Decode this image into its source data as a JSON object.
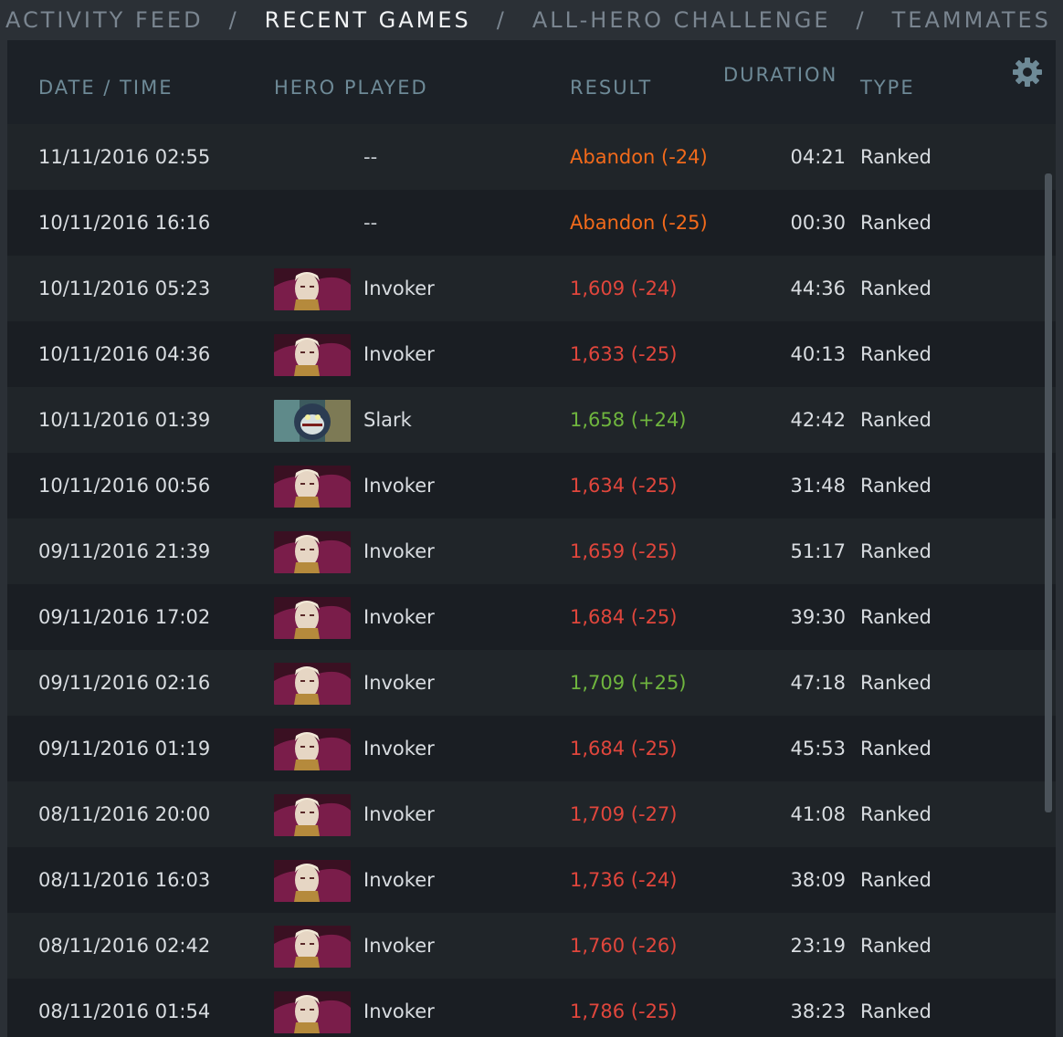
{
  "nav": {
    "tabs": [
      {
        "label": "ACTIVITY FEED",
        "active": false
      },
      {
        "label": "RECENT GAMES",
        "active": true
      },
      {
        "label": "ALL-HERO CHALLENGE",
        "active": false
      },
      {
        "label": "TEAMMATES",
        "active": false
      }
    ],
    "separator": "/"
  },
  "table": {
    "headers": {
      "date": "DATE / TIME",
      "hero": "HERO PLAYED",
      "result": "RESULT",
      "duration": "DURATION",
      "type": "TYPE"
    },
    "settings_icon": "gear-icon",
    "rows": [
      {
        "date": "11/11/2016  02:55",
        "hero": "--",
        "hero_icon": "",
        "result": "Abandon (-24)",
        "status": "abandon",
        "duration": "04:21",
        "type": "Ranked"
      },
      {
        "date": "10/11/2016  16:16",
        "hero": "--",
        "hero_icon": "",
        "result": "Abandon (-25)",
        "status": "abandon",
        "duration": "00:30",
        "type": "Ranked"
      },
      {
        "date": "10/11/2016  05:23",
        "hero": "Invoker",
        "hero_icon": "invoker-portrait",
        "result": "1,609 (-24)",
        "status": "loss",
        "duration": "44:36",
        "type": "Ranked"
      },
      {
        "date": "10/11/2016  04:36",
        "hero": "Invoker",
        "hero_icon": "invoker-portrait",
        "result": "1,633 (-25)",
        "status": "loss",
        "duration": "40:13",
        "type": "Ranked"
      },
      {
        "date": "10/11/2016  01:39",
        "hero": "Slark",
        "hero_icon": "slark-portrait",
        "result": "1,658 (+24)",
        "status": "win",
        "duration": "42:42",
        "type": "Ranked"
      },
      {
        "date": "10/11/2016  00:56",
        "hero": "Invoker",
        "hero_icon": "invoker-portrait",
        "result": "1,634 (-25)",
        "status": "loss",
        "duration": "31:48",
        "type": "Ranked"
      },
      {
        "date": "09/11/2016  21:39",
        "hero": "Invoker",
        "hero_icon": "invoker-portrait",
        "result": "1,659 (-25)",
        "status": "loss",
        "duration": "51:17",
        "type": "Ranked"
      },
      {
        "date": "09/11/2016  17:02",
        "hero": "Invoker",
        "hero_icon": "invoker-portrait",
        "result": "1,684 (-25)",
        "status": "loss",
        "duration": "39:30",
        "type": "Ranked"
      },
      {
        "date": "09/11/2016  02:16",
        "hero": "Invoker",
        "hero_icon": "invoker-portrait",
        "result": "1,709 (+25)",
        "status": "win",
        "duration": "47:18",
        "type": "Ranked"
      },
      {
        "date": "09/11/2016  01:19",
        "hero": "Invoker",
        "hero_icon": "invoker-portrait",
        "result": "1,684 (-25)",
        "status": "loss",
        "duration": "45:53",
        "type": "Ranked"
      },
      {
        "date": "08/11/2016  20:00",
        "hero": "Invoker",
        "hero_icon": "invoker-portrait",
        "result": "1,709 (-27)",
        "status": "loss",
        "duration": "41:08",
        "type": "Ranked"
      },
      {
        "date": "08/11/2016  16:03",
        "hero": "Invoker",
        "hero_icon": "invoker-portrait",
        "result": "1,736 (-24)",
        "status": "loss",
        "duration": "38:09",
        "type": "Ranked"
      },
      {
        "date": "08/11/2016  02:42",
        "hero": "Invoker",
        "hero_icon": "invoker-portrait",
        "result": "1,760 (-26)",
        "status": "loss",
        "duration": "23:19",
        "type": "Ranked"
      },
      {
        "date": "08/11/2016  01:54",
        "hero": "Invoker",
        "hero_icon": "invoker-portrait",
        "result": "1,786 (-25)",
        "status": "loss",
        "duration": "38:23",
        "type": "Ranked"
      }
    ]
  },
  "colors": {
    "abandon": "#f26a1b",
    "loss": "#e0463c",
    "win": "#6fb53e",
    "header": "#6e8a97",
    "nav_active": "#f2f4f6",
    "nav_inactive": "#7a8590"
  }
}
